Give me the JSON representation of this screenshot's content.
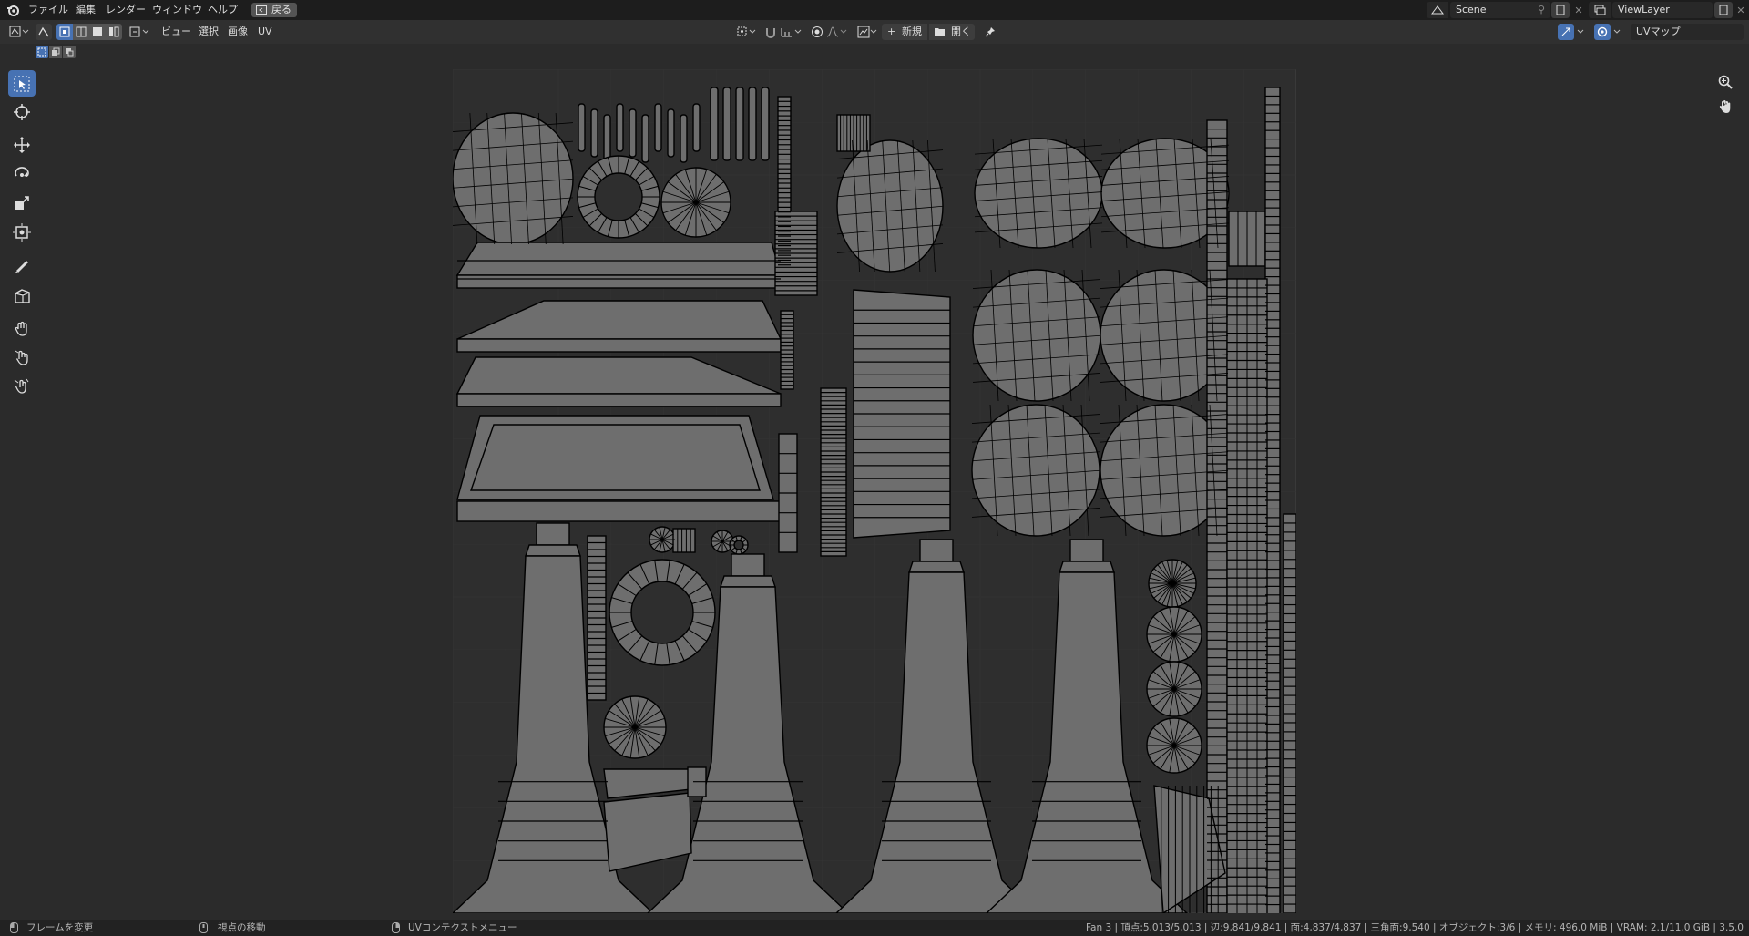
{
  "menus": [
    "ファイル",
    "編集",
    "レンダー",
    "ウィンドウ",
    "ヘルプ"
  ],
  "back_label": "戻る",
  "scene": {
    "label": "Scene"
  },
  "viewlayer": {
    "label": "ViewLayer"
  },
  "editor_menus": [
    "ビュー",
    "選択",
    "画像",
    "UV"
  ],
  "image_buttons": {
    "new": "新規",
    "open": "開く"
  },
  "uv_map": "UVマップ",
  "status": {
    "left1": "フレームを変更",
    "left2": "視点の移動",
    "left3": "UVコンテクストメニュー",
    "right": "Fan 3 | 頂点:5,013/5,013 | 辺:9,841/9,841 | 面:4,837/4,837 | 三角面:9,540 | オブジェクト:3/6 | メモリ: 496.0 MiB | VRAM: 2.1/11.0 GiB | 3.5.0"
  },
  "colors": {
    "accent": "#4772b3",
    "bg": "#2b2b2b",
    "uv_face": "#6e6e6e",
    "uv_edge": "#000000"
  }
}
